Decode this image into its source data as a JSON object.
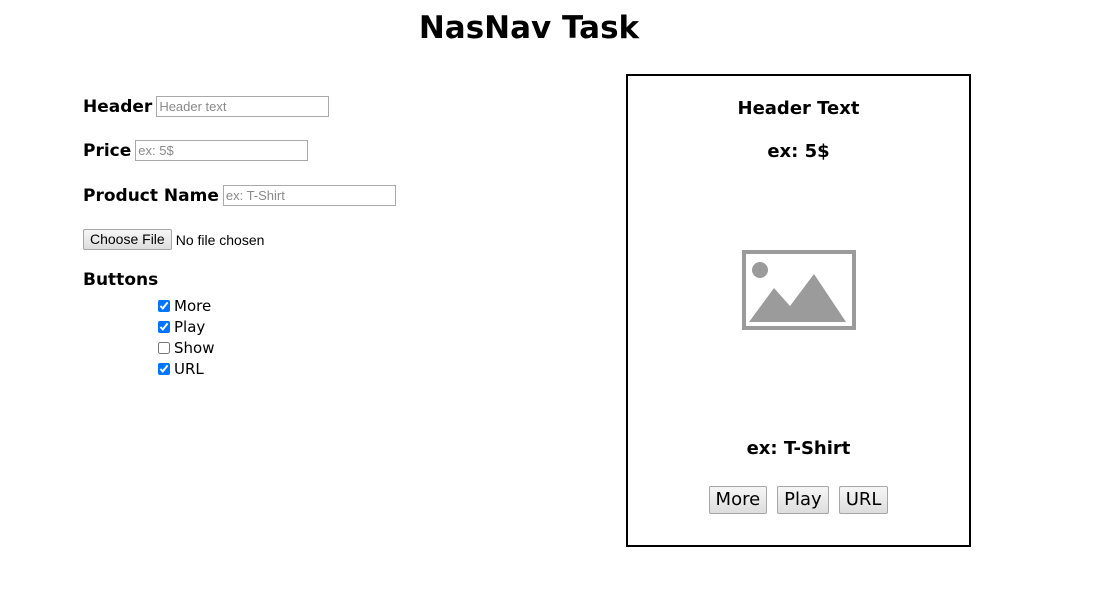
{
  "page": {
    "title": "NasNav Task"
  },
  "form": {
    "header": {
      "label": "Header",
      "placeholder": "Header text",
      "value": ""
    },
    "price": {
      "label": "Price",
      "placeholder": "ex: 5$",
      "value": ""
    },
    "product_name": {
      "label": "Product Name",
      "placeholder": "ex: T-Shirt",
      "value": ""
    },
    "file": {
      "button_label": "Choose File",
      "status": "No file chosen"
    },
    "buttons": {
      "heading": "Buttons",
      "options": [
        {
          "label": "More",
          "checked": true
        },
        {
          "label": "Play",
          "checked": true
        },
        {
          "label": "Show",
          "checked": false
        },
        {
          "label": "URL",
          "checked": true
        }
      ]
    }
  },
  "preview": {
    "header": "Header Text",
    "price": "ex: 5$",
    "image_icon": "image-placeholder-icon",
    "product_name": "ex: T-Shirt",
    "buttons": [
      {
        "label": "More"
      },
      {
        "label": "Play"
      },
      {
        "label": "URL"
      }
    ]
  },
  "colors": {
    "placeholder_icon": "#9b9b9b",
    "card_border": "#000000"
  }
}
